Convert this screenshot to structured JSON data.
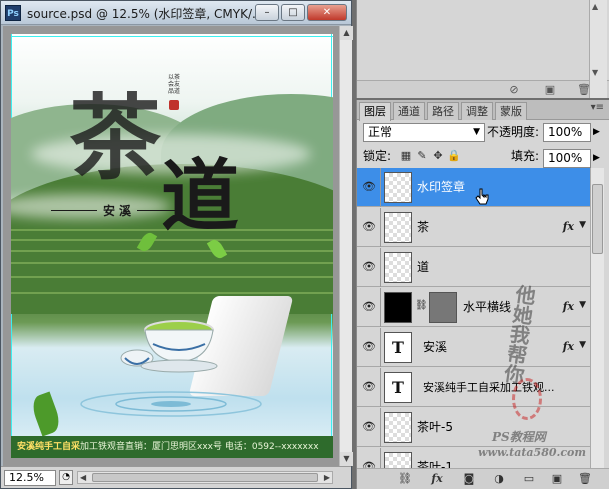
{
  "document": {
    "title": "source.psd @ 12.5% (水印签章, CMYK/...",
    "app_icon": "Ps",
    "window_buttons": [
      "–",
      "□",
      "✕"
    ],
    "zoom": "12.5%"
  },
  "poster": {
    "calligraphy_cha": "茶",
    "calligraphy_dao": "道",
    "subtitle": "安溪",
    "seal_lines": [
      "以茶",
      "会友",
      "品道"
    ],
    "footer_brand": "安溪纯手工自采",
    "footer_text": "加工铁观音直销：厦门思明区xxx号    电话：0592--xxxxxxx"
  },
  "layers_panel": {
    "tabs": [
      "图层",
      "通道",
      "路径",
      "调整",
      "蒙版"
    ],
    "active_tab": "图层",
    "blend_mode": "正常",
    "opacity_label": "不透明度:",
    "opacity_value": "100%",
    "lock_label": "锁定:",
    "fill_label": "填充:",
    "fill_value": "100%",
    "layers": [
      {
        "name": "水印签章",
        "thumb": "checker",
        "fx": false,
        "selected": true
      },
      {
        "name": "茶",
        "thumb": "checker",
        "fx": true,
        "selected": false
      },
      {
        "name": "道",
        "thumb": "checker",
        "fx": false,
        "selected": false
      },
      {
        "name": "水平横线",
        "thumb": "black",
        "fx": true,
        "mask": true,
        "selected": false
      },
      {
        "name": "安溪",
        "thumb": "text",
        "fx": true,
        "selected": false
      },
      {
        "name": "安溪纯手工自采加工铁观...",
        "thumb": "text",
        "fx": false,
        "selected": false
      },
      {
        "name": "茶叶-5",
        "thumb": "checker",
        "fx": false,
        "selected": false
      },
      {
        "name": "茶叶-1",
        "thumb": "checker",
        "fx": false,
        "selected": false
      }
    ]
  },
  "watermark": {
    "vertical_text": "他她我帮你",
    "footer_line1": "PS教程网",
    "footer_line2": "www.tata580.com"
  },
  "colors": {
    "selection": "#3d8ee8",
    "panel_bg": "#d6d6d6",
    "guide": "#3cf0f0"
  }
}
